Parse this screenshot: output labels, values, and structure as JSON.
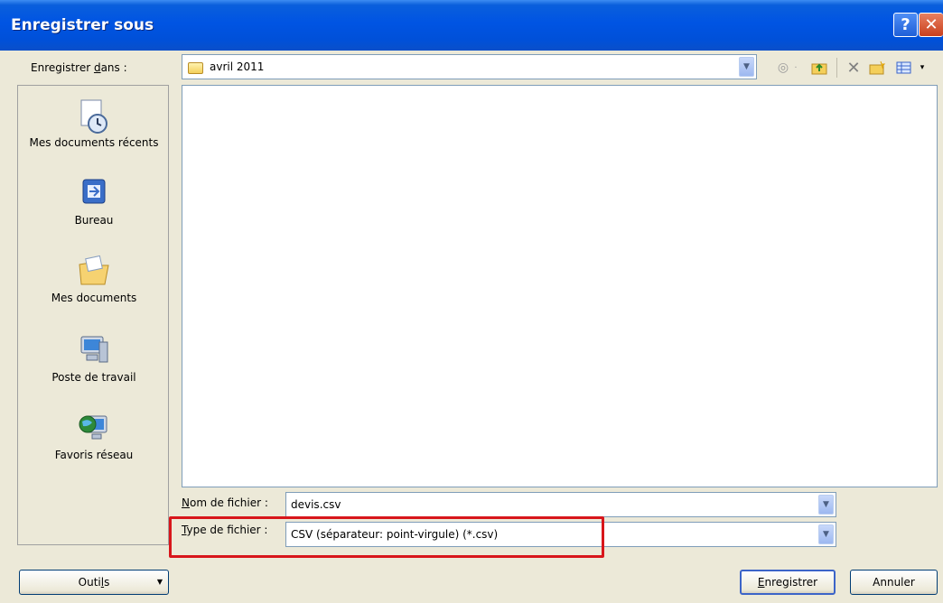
{
  "window": {
    "title": "Enregistrer sous",
    "help_glyph": "?",
    "close_glyph": "✕"
  },
  "save_in": {
    "label_prefix": "Enregistrer ",
    "label_mnemonic": "d",
    "label_suffix": "ans :",
    "current_folder": "avril 2011"
  },
  "toolbar": {
    "icons": [
      "back-icon",
      "up-folder-icon",
      "delete-icon",
      "new-folder-icon",
      "views-icon"
    ]
  },
  "places": [
    {
      "label": "Mes documents récents",
      "icon": "recent-documents-icon"
    },
    {
      "label": "Bureau",
      "icon": "desktop-icon"
    },
    {
      "label": "Mes documents",
      "icon": "my-documents-icon"
    },
    {
      "label": "Poste de travail",
      "icon": "my-computer-icon"
    },
    {
      "label": "Favoris réseau",
      "icon": "network-places-icon"
    }
  ],
  "filename": {
    "label_mnemonic": "N",
    "label_rest": "om de fichier :",
    "value": "devis.csv"
  },
  "filetype": {
    "label_mnemonic": "T",
    "label_rest": "ype de fichier :",
    "value": "CSV (séparateur: point-virgule) (*.csv)"
  },
  "buttons": {
    "tools_prefix": "Outi",
    "tools_mnemonic": "l",
    "tools_suffix": "s",
    "save_mnemonic": "E",
    "save_rest": "nregistrer",
    "cancel": "Annuler"
  },
  "colors": {
    "titlebar": "#0054e3",
    "highlight": "#d8161b"
  }
}
